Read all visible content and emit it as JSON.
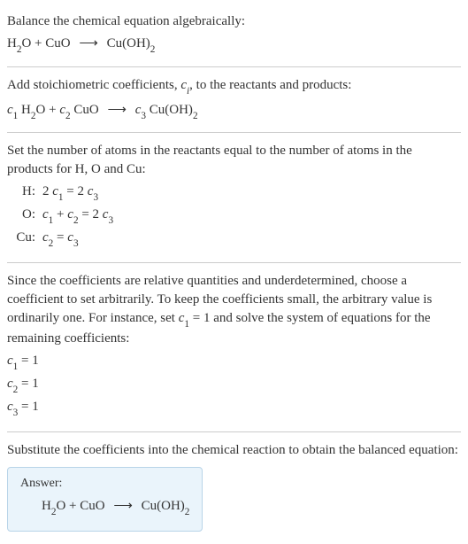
{
  "section1": {
    "intro": "Balance the chemical equation algebraically:",
    "eq_h2o": "H",
    "eq_h2o_sub": "2",
    "eq_o": "O + CuO",
    "eq_arrow": "⟶",
    "eq_cuoh": "Cu(OH)",
    "eq_cuoh_sub": "2"
  },
  "section2": {
    "intro_a": "Add stoichiometric coefficients, ",
    "intro_c": "c",
    "intro_i": "i",
    "intro_b": ", to the reactants and products:",
    "c1": "c",
    "c1sub": "1",
    "sp1": " H",
    "h2sub": "2",
    "o_plus": "O + ",
    "c2": "c",
    "c2sub": "2",
    "cuo": " CuO",
    "arrow": "⟶",
    "c3": "c",
    "c3sub": "3",
    "cuoh": " Cu(OH)",
    "cuohsub": "2"
  },
  "section3": {
    "intro": "Set the number of atoms in the reactants equal to the number of atoms in the products for H, O and Cu:",
    "rows": [
      {
        "label": "H:",
        "eq_a": "2 ",
        "eq_c1": "c",
        "eq_c1s": "1",
        "eq_mid": " = 2 ",
        "eq_c3": "c",
        "eq_c3s": "3"
      },
      {
        "label": "O:",
        "eq_c1": "c",
        "eq_c1s": "1",
        "eq_plus": " + ",
        "eq_c2": "c",
        "eq_c2s": "2",
        "eq_mid": " = 2 ",
        "eq_c3": "c",
        "eq_c3s": "3"
      },
      {
        "label": "Cu:",
        "eq_c2": "c",
        "eq_c2s": "2",
        "eq_mid": " = ",
        "eq_c3": "c",
        "eq_c3s": "3"
      }
    ]
  },
  "section4": {
    "intro_a": "Since the coefficients are relative quantities and underdetermined, choose a coefficient to set arbitrarily. To keep the coefficients small, the arbitrary value is ordinarily one. For instance, set ",
    "c1": "c",
    "c1s": "1",
    "intro_b": " = 1 and solve the system of equations for the remaining coefficients:",
    "lines": [
      {
        "c": "c",
        "s": "1",
        "v": " = 1"
      },
      {
        "c": "c",
        "s": "2",
        "v": " = 1"
      },
      {
        "c": "c",
        "s": "3",
        "v": " = 1"
      }
    ]
  },
  "section5": {
    "intro": "Substitute the coefficients into the chemical reaction to obtain the balanced equation:",
    "answer_label": "Answer:",
    "eq_h2o": "H",
    "eq_h2o_sub": "2",
    "eq_o": "O + CuO",
    "eq_arrow": "⟶",
    "eq_cuoh": "Cu(OH)",
    "eq_cuoh_sub": "2"
  }
}
